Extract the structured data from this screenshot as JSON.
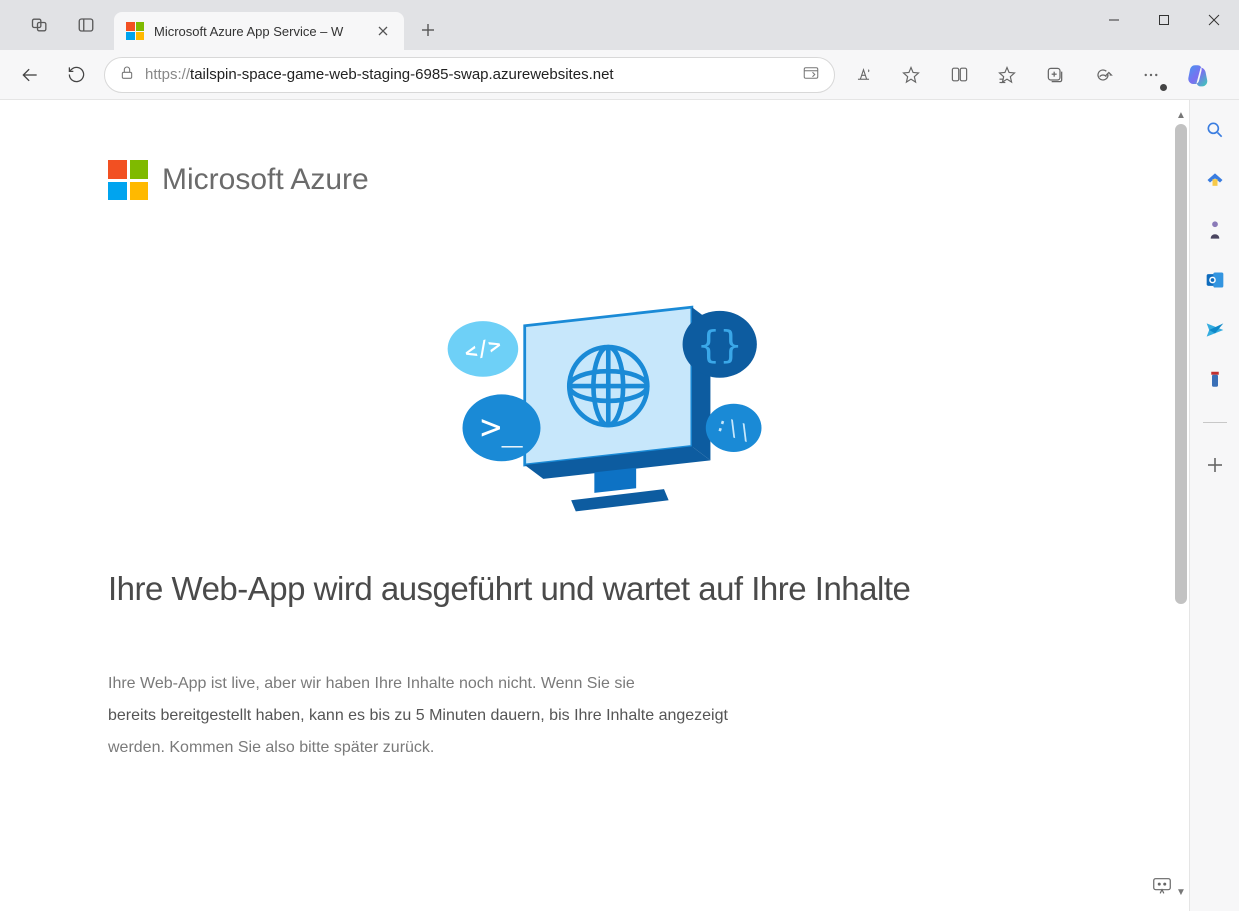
{
  "window": {
    "tab_title": "Microsoft Azure App Service – W"
  },
  "toolbar": {
    "url_proto": "https://",
    "url_host": "tailspin-space-game-web-staging-6985-swap.azurewebsites.net"
  },
  "page": {
    "brand": "Microsoft Azure",
    "heading": "Ihre Web-App wird ausgeführt und wartet auf Ihre Inhalte",
    "body_line1": "Ihre Web-App ist live, aber wir haben Ihre Inhalte noch nicht. Wenn Sie sie",
    "body_strong": "bereits bereitgestellt haben, kann es bis zu 5 Minuten dauern, bis Ihre Inhalte angezeigt",
    "body_line2": "werden. Kommen Sie also bitte später zurück."
  }
}
